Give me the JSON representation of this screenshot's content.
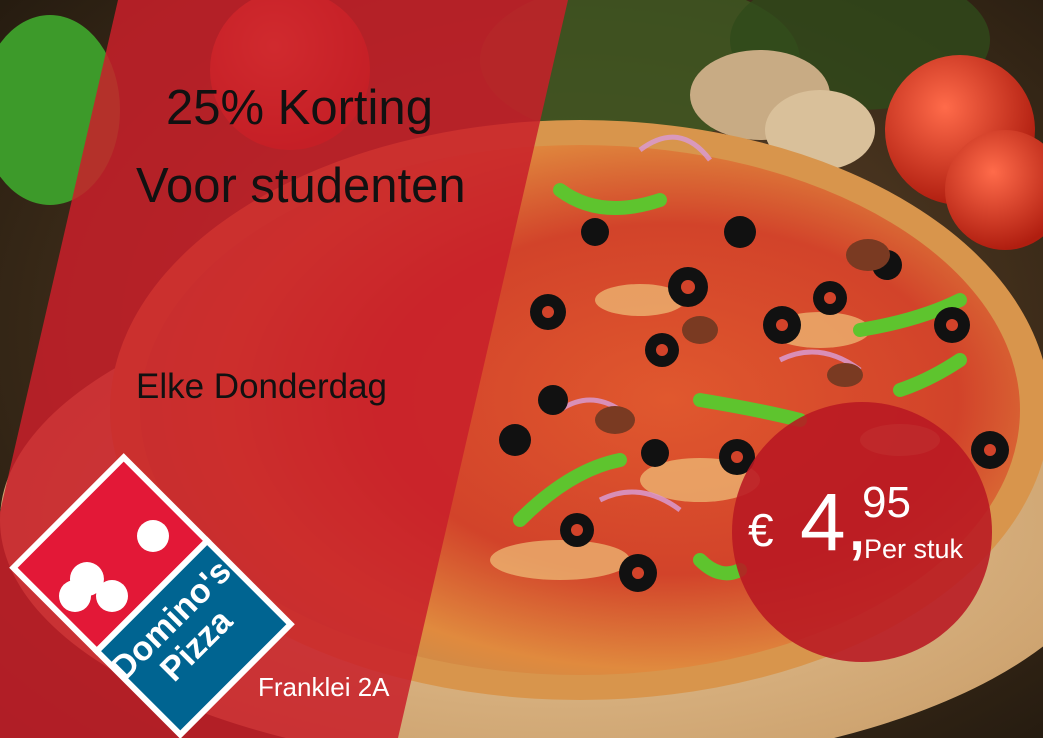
{
  "promo": {
    "headline_line1": "25% Korting",
    "headline_line2": "Voor studenten",
    "day": "Elke Donderdag"
  },
  "price": {
    "currency": "€",
    "whole": "4",
    "cents": "95",
    "unit": "Per stuk"
  },
  "brand": {
    "name_line1": "Domino's",
    "name_line2": "Pizza"
  },
  "location": {
    "address": "Franklei 2A"
  },
  "colors": {
    "banner_red": "#c8202a",
    "badge_red": "#b81822",
    "logo_red": "#e31837",
    "logo_blue": "#006491"
  },
  "icons": {
    "logo": "dominos-domino-tile-icon"
  }
}
